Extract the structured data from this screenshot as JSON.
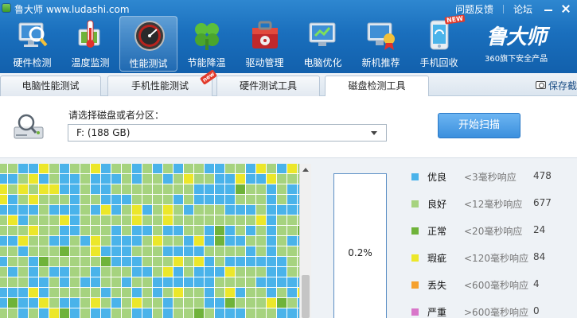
{
  "window": {
    "title": "鲁大师 www.ludashi.com",
    "links": [
      "问题反馈",
      "论坛"
    ]
  },
  "nav": [
    {
      "label": "硬件检测",
      "icon": "monitor-magnifier-icon"
    },
    {
      "label": "温度监测",
      "icon": "thermometer-icon"
    },
    {
      "label": "性能测试",
      "icon": "speedometer-icon",
      "active": true
    },
    {
      "label": "节能降温",
      "icon": "clover-icon"
    },
    {
      "label": "驱动管理",
      "icon": "toolbox-icon"
    },
    {
      "label": "电脑优化",
      "icon": "optimize-monitor-icon"
    },
    {
      "label": "新机推荐",
      "icon": "monitor-ribbon-icon"
    },
    {
      "label": "手机回收",
      "icon": "phone-icon",
      "badge": "NEW"
    }
  ],
  "brand": {
    "name": "鲁大师",
    "sub": "360旗下安全产品"
  },
  "tabs": [
    {
      "label": "电脑性能测试"
    },
    {
      "label": "手机性能测试",
      "badge": "new"
    },
    {
      "label": "硬件测试工具"
    },
    {
      "label": "磁盘检测工具",
      "active": true
    }
  ],
  "save_report": "保存截",
  "select": {
    "label": "请选择磁盘或者分区：",
    "value": "F:  (188 GB)"
  },
  "scan_button": "开始扫描",
  "progress": {
    "value": 0.002,
    "text": "0.2%"
  },
  "legend": [
    {
      "name": "优良",
      "range": "<3毫秒响应",
      "count": "478",
      "color": "#4ab3ea"
    },
    {
      "name": "良好",
      "range": "<12毫秒响应",
      "count": "677",
      "color": "#a6d37f"
    },
    {
      "name": "正常",
      "range": "<20毫秒响应",
      "count": "24",
      "color": "#6fb33a"
    },
    {
      "name": "瑕疵",
      "range": "<120毫秒响应",
      "count": "84",
      "color": "#ece72a"
    },
    {
      "name": "丢失",
      "range": "<600毫秒响应",
      "count": "4",
      "color": "#f5a12e"
    },
    {
      "name": "严重",
      "range": ">600毫秒响应",
      "count": "0",
      "color": "#d876c9"
    }
  ],
  "colors": {
    "banner": "#1a6fbd",
    "blue_cell": "#4ab3ea",
    "green_cell": "#a6d37f",
    "dark_green_cell": "#6fb33a",
    "yellow_cell": "#ece72a"
  }
}
